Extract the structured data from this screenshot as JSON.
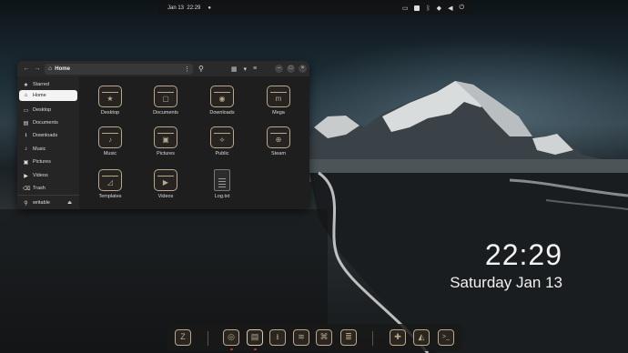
{
  "topbar": {
    "date": "Jan 13",
    "time": "22:29"
  },
  "clock": {
    "time": "22:29",
    "date": "Saturday Jan 13"
  },
  "file_manager": {
    "path_label": "Home",
    "sidebar": [
      {
        "label": "Starred",
        "icon": "star-icon",
        "glyph": "★",
        "active": false
      },
      {
        "label": "Home",
        "icon": "home-icon",
        "glyph": "⌂",
        "active": true
      },
      {
        "label": "Desktop",
        "icon": "desktop-icon",
        "glyph": "▭",
        "active": false
      },
      {
        "label": "Documents",
        "icon": "documents-icon",
        "glyph": "▤",
        "active": false
      },
      {
        "label": "Downloads",
        "icon": "downloads-icon",
        "glyph": "⭳",
        "active": false
      },
      {
        "label": "Music",
        "icon": "music-icon",
        "glyph": "♪",
        "active": false
      },
      {
        "label": "Pictures",
        "icon": "pictures-icon",
        "glyph": "▣",
        "active": false
      },
      {
        "label": "Videos",
        "icon": "videos-icon",
        "glyph": "▶",
        "active": false
      },
      {
        "label": "Trash",
        "icon": "trash-icon",
        "glyph": "🗑",
        "active": false
      }
    ],
    "device": {
      "label": "writable",
      "icon": "usb-icon"
    },
    "items": [
      {
        "label": "Desktop",
        "type": "folder",
        "emblem": "★"
      },
      {
        "label": "Documents",
        "type": "folder",
        "emblem": "▢"
      },
      {
        "label": "Downloads",
        "type": "folder",
        "emblem": "◉"
      },
      {
        "label": "Mega",
        "type": "folder",
        "emblem": "m"
      },
      {
        "label": "Music",
        "type": "folder",
        "emblem": "♪"
      },
      {
        "label": "Pictures",
        "type": "folder",
        "emblem": "▣"
      },
      {
        "label": "Public",
        "type": "folder",
        "emblem": "⟡"
      },
      {
        "label": "Steam",
        "type": "folder",
        "emblem": "⊕"
      },
      {
        "label": "Templates",
        "type": "folder",
        "emblem": "◿"
      },
      {
        "label": "Videos",
        "type": "folder",
        "emblem": "▶"
      },
      {
        "label": "Log.txt",
        "type": "text-file",
        "emblem": ""
      }
    ]
  },
  "dock": [
    {
      "name": "app-grid-icon",
      "glyph": "Z",
      "running": false
    },
    {
      "name": "browser-icon",
      "glyph": "◎",
      "running": true
    },
    {
      "name": "files-icon",
      "glyph": "▤",
      "running": true
    },
    {
      "name": "downloads-app-icon",
      "glyph": "⭳",
      "running": false
    },
    {
      "name": "rss-icon",
      "glyph": "≋",
      "running": false
    },
    {
      "name": "gamepad-icon",
      "glyph": "⌘",
      "running": false
    },
    {
      "name": "layers-icon",
      "glyph": "≣",
      "running": false
    },
    {
      "name": "extensions-icon",
      "glyph": "✚",
      "running": false
    },
    {
      "name": "app-icon",
      "glyph": "◭",
      "running": false
    },
    {
      "name": "terminal-icon",
      "glyph": ">_",
      "running": false
    }
  ]
}
